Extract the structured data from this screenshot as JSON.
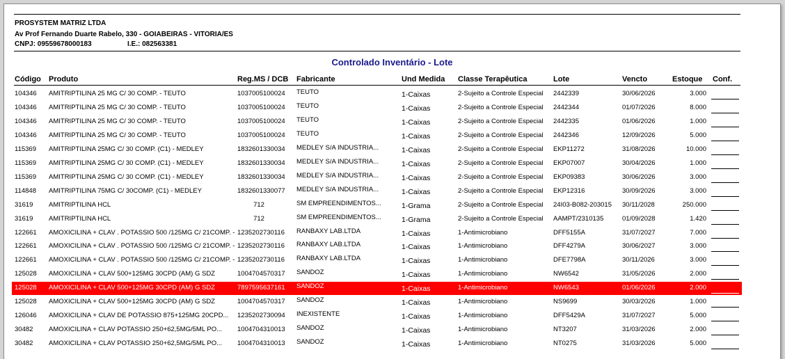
{
  "company": {
    "name": "PROSYSTEM MATRIZ LTDA",
    "address": "Av Prof Fernando Duarte Rabelo, 330 - GOIABEIRAS - VITORIA/ES",
    "cnpj": "CNPJ: 09559678000183",
    "ie": "I.E.: 082563381"
  },
  "report_title": "Controlado Inventário - Lote",
  "columns": [
    "Código",
    "Produto",
    "Reg.MS / DCB",
    "Fabricante",
    "Und Medida",
    "Classe Terapêutica",
    "Lote",
    "Vencto",
    "Estoque",
    "Conf."
  ],
  "rows": [
    {
      "codigo": "104346",
      "produto": "AMITRIPTILINA 25 MG C/ 30 COMP. - TEUTO",
      "reg": "1037005100024",
      "fabricante": "TEUTO",
      "und": "1-Caixas",
      "classe": "2-Sujeito a Controle Especial",
      "lote": "2442339",
      "vencto": "30/06/2026",
      "estoque": "3.000",
      "highlight": false
    },
    {
      "codigo": "104346",
      "produto": "AMITRIPTILINA 25 MG C/ 30 COMP. - TEUTO",
      "reg": "1037005100024",
      "fabricante": "TEUTO",
      "und": "1-Caixas",
      "classe": "2-Sujeito a Controle Especial",
      "lote": "2442344",
      "vencto": "01/07/2026",
      "estoque": "8.000",
      "highlight": false
    },
    {
      "codigo": "104346",
      "produto": "AMITRIPTILINA 25 MG C/ 30 COMP. - TEUTO",
      "reg": "1037005100024",
      "fabricante": "TEUTO",
      "und": "1-Caixas",
      "classe": "2-Sujeito a Controle Especial",
      "lote": "2442335",
      "vencto": "01/06/2026",
      "estoque": "1.000",
      "highlight": false
    },
    {
      "codigo": "104346",
      "produto": "AMITRIPTILINA 25 MG C/ 30 COMP. - TEUTO",
      "reg": "1037005100024",
      "fabricante": "TEUTO",
      "und": "1-Caixas",
      "classe": "2-Sujeito a Controle Especial",
      "lote": "2442346",
      "vencto": "12/09/2026",
      "estoque": "5.000",
      "highlight": false
    },
    {
      "codigo": "115369",
      "produto": "AMITRIPTILINA 25MG C/ 30 COMP. (C1) - MEDLEY",
      "reg": "1832601330034",
      "fabricante": "MEDLEY S/A INDUSTRIA...",
      "und": "1-Caixas",
      "classe": "2-Sujeito a Controle Especial",
      "lote": "EKP11272",
      "vencto": "31/08/2026",
      "estoque": "10.000",
      "highlight": false
    },
    {
      "codigo": "115369",
      "produto": "AMITRIPTILINA 25MG C/ 30 COMP. (C1) - MEDLEY",
      "reg": "1832601330034",
      "fabricante": "MEDLEY S/A INDUSTRIA...",
      "und": "1-Caixas",
      "classe": "2-Sujeito a Controle Especial",
      "lote": "EKP07007",
      "vencto": "30/04/2026",
      "estoque": "1.000",
      "highlight": false
    },
    {
      "codigo": "115369",
      "produto": "AMITRIPTILINA 25MG C/ 30 COMP. (C1) - MEDLEY",
      "reg": "1832601330034",
      "fabricante": "MEDLEY S/A INDUSTRIA...",
      "und": "1-Caixas",
      "classe": "2-Sujeito a Controle Especial",
      "lote": "EKP09383",
      "vencto": "30/06/2026",
      "estoque": "3.000",
      "highlight": false
    },
    {
      "codigo": "114848",
      "produto": "AMITRIPTILINA 75MG C/ 30COMP. (C1) - MEDLEY",
      "reg": "1832601330077",
      "fabricante": "MEDLEY S/A INDUSTRIA...",
      "und": "1-Caixas",
      "classe": "2-Sujeito a Controle Especial",
      "lote": "EKP12316",
      "vencto": "30/09/2026",
      "estoque": "3.000",
      "highlight": false
    },
    {
      "codigo": "31619",
      "produto": "AMITRIPTILINA HCL",
      "reg": "712",
      "fabricante": "SM EMPREENDIMENTOS...",
      "und": "1-Grama",
      "classe": "2-Sujeito a Controle Especial",
      "lote": "24I03-B082-203015",
      "vencto": "30/11/2028",
      "estoque": "250.000",
      "highlight": false
    },
    {
      "codigo": "31619",
      "produto": "AMITRIPTILINA HCL",
      "reg": "712",
      "fabricante": "SM EMPREENDIMENTOS...",
      "und": "1-Grama",
      "classe": "2-Sujeito a Controle Especial",
      "lote": "AAMPT/2310135",
      "vencto": "01/09/2028",
      "estoque": "1.420",
      "highlight": false
    },
    {
      "codigo": "122661",
      "produto": "AMOXICILINA + CLAV . POTASSIO 500 /125MG C/ 21COMP. -...",
      "reg": "1235202730116",
      "fabricante": "RANBAXY LAB.LTDA",
      "und": "1-Caixas",
      "classe": "1-Antimicrobiano",
      "lote": "DFF5155A",
      "vencto": "31/07/2027",
      "estoque": "7.000",
      "highlight": false
    },
    {
      "codigo": "122661",
      "produto": "AMOXICILINA + CLAV . POTASSIO 500 /125MG C/ 21COMP. -...",
      "reg": "1235202730116",
      "fabricante": "RANBAXY LAB.LTDA",
      "und": "1-Caixas",
      "classe": "1-Antimicrobiano",
      "lote": "DFF4279A",
      "vencto": "30/06/2027",
      "estoque": "3.000",
      "highlight": false
    },
    {
      "codigo": "122661",
      "produto": "AMOXICILINA + CLAV . POTASSIO 500 /125MG C/ 21COMP. -...",
      "reg": "1235202730116",
      "fabricante": "RANBAXY LAB.LTDA",
      "und": "1-Caixas",
      "classe": "1-Antimicrobiano",
      "lote": "DFE7798A",
      "vencto": "30/11/2026",
      "estoque": "3.000",
      "highlight": false
    },
    {
      "codigo": "125028",
      "produto": "AMOXICILINA + CLAV 500+125MG 30CPD (AM) G SDZ",
      "reg": "1004704570317",
      "fabricante": "SANDOZ",
      "und": "1-Caixas",
      "classe": "1-Antimicrobiano",
      "lote": "NW6542",
      "vencto": "31/05/2026",
      "estoque": "2.000",
      "highlight": false
    },
    {
      "codigo": "125028",
      "produto": "AMOXICILINA + CLAV 500+125MG 30CPD (AM) G SDZ",
      "reg": "7897595637161",
      "fabricante": "SANDOZ",
      "und": "1-Caixas",
      "classe": "1-Antimicrobiano",
      "lote": "NW6543",
      "vencto": "01/06/2026",
      "estoque": "2.000",
      "highlight": true
    },
    {
      "codigo": "125028",
      "produto": "AMOXICILINA + CLAV 500+125MG 30CPD (AM) G SDZ",
      "reg": "1004704570317",
      "fabricante": "SANDOZ",
      "und": "1-Caixas",
      "classe": "1-Antimicrobiano",
      "lote": "NS9699",
      "vencto": "30/03/2026",
      "estoque": "1.000",
      "highlight": false
    },
    {
      "codigo": "126046",
      "produto": "AMOXICILINA + CLAV DE POTASSIO 875+125MG 20CPD...",
      "reg": "1235202730094",
      "fabricante": "INEXISTENTE",
      "und": "1-Caixas",
      "classe": "1-Antimicrobiano",
      "lote": "DFF5429A",
      "vencto": "31/07/2027",
      "estoque": "5.000",
      "highlight": false
    },
    {
      "codigo": "30482",
      "produto": "AMOXICILINA + CLAV POTASSIO 250+62,5MG/5ML PO...",
      "reg": "1004704310013",
      "fabricante": "SANDOZ",
      "und": "1-Caixas",
      "classe": "1-Antimicrobiano",
      "lote": "NT3207",
      "vencto": "31/03/2026",
      "estoque": "2.000",
      "highlight": false
    },
    {
      "codigo": "30482",
      "produto": "AMOXICILINA + CLAV POTASSIO 250+62,5MG/5ML PO...",
      "reg": "1004704310013",
      "fabricante": "SANDOZ",
      "und": "1-Caixas",
      "classe": "1-Antimicrobiano",
      "lote": "NT0275",
      "vencto": "31/03/2026",
      "estoque": "5.000",
      "highlight": false
    }
  ]
}
